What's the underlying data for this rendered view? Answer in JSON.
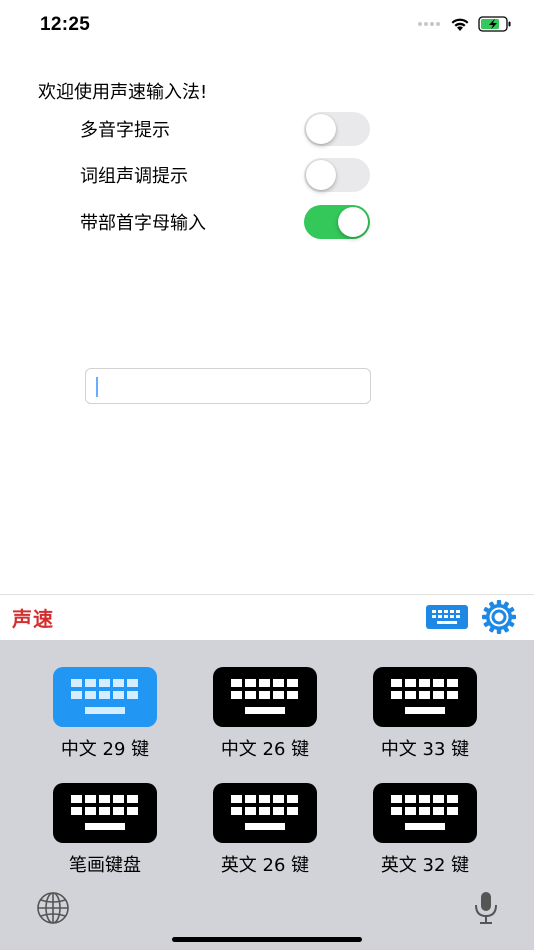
{
  "status_bar": {
    "time": "12:25"
  },
  "settings": {
    "welcome": "欢迎使用声速输入法!",
    "options": [
      {
        "label": "多音字提示",
        "enabled": false
      },
      {
        "label": "词组声调提示",
        "enabled": false
      },
      {
        "label": "带部首字母输入",
        "enabled": true
      }
    ]
  },
  "text_input": {
    "value": ""
  },
  "keyboard_toolbar": {
    "brand": "声速",
    "icons": [
      "keyboard-switch-icon",
      "gear-icon"
    ],
    "colors": {
      "brand": "#d32f2f",
      "accent": "#1e88e5"
    }
  },
  "keyboards": {
    "items": [
      {
        "label": "中文 29 键",
        "selected": true
      },
      {
        "label": "中文 26 键",
        "selected": false
      },
      {
        "label": "中文 33 键",
        "selected": false
      },
      {
        "label": "笔画键盘",
        "selected": false
      },
      {
        "label": "英文 26 键",
        "selected": false
      },
      {
        "label": "英文 32 键",
        "selected": false
      }
    ],
    "bottom_icons": [
      "globe-icon",
      "microphone-icon"
    ]
  },
  "colors": {
    "toggle_on": "#34c759",
    "toggle_off": "#e9e9eb",
    "selected": "#2196f3",
    "panel": "#d1d3d9"
  }
}
